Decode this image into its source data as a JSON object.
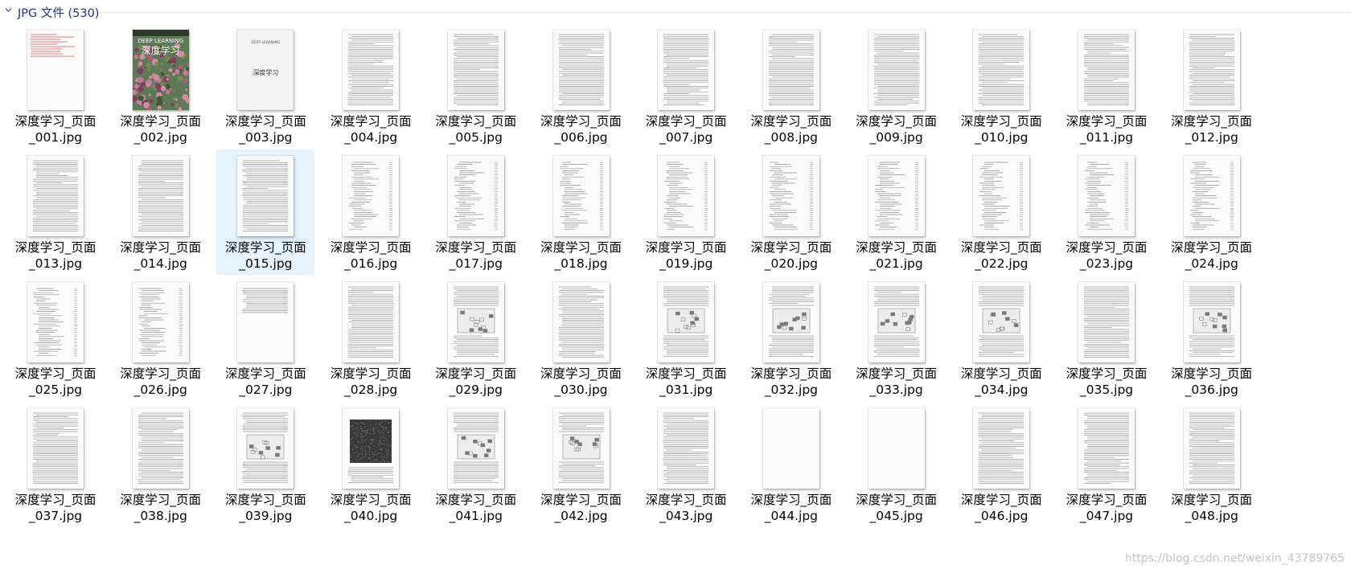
{
  "group": {
    "title": "JPG 文件 (530)",
    "chevron_icon": "chevron-down-icon"
  },
  "watermark": "https://blog.csdn.net/weixin_43789765",
  "colors": {
    "header_text": "#1e3287",
    "selection": "#e5f3ff"
  },
  "selected_index": 14,
  "covers": {
    "2": {
      "top": "DEEP LEARNING",
      "title": "深度学习"
    },
    "3": {
      "top": "DEEP LEARNING",
      "title": "深度学习"
    }
  },
  "files": [
    {
      "line1": "深度学习_页面",
      "line2": "_001.jpg",
      "kind": "notice"
    },
    {
      "line1": "深度学习_页面",
      "line2": "_002.jpg",
      "kind": "photo-cover"
    },
    {
      "line1": "深度学习_页面",
      "line2": "_003.jpg",
      "kind": "title-page"
    },
    {
      "line1": "深度学习_页面",
      "line2": "_004.jpg",
      "kind": "text"
    },
    {
      "line1": "深度学习_页面",
      "line2": "_005.jpg",
      "kind": "text"
    },
    {
      "line1": "深度学习_页面",
      "line2": "_006.jpg",
      "kind": "text"
    },
    {
      "line1": "深度学习_页面",
      "line2": "_007.jpg",
      "kind": "text"
    },
    {
      "line1": "深度学习_页面",
      "line2": "_008.jpg",
      "kind": "text"
    },
    {
      "line1": "深度学习_页面",
      "line2": "_009.jpg",
      "kind": "text"
    },
    {
      "line1": "深度学习_页面",
      "line2": "_010.jpg",
      "kind": "text"
    },
    {
      "line1": "深度学习_页面",
      "line2": "_011.jpg",
      "kind": "text"
    },
    {
      "line1": "深度学习_页面",
      "line2": "_012.jpg",
      "kind": "text"
    },
    {
      "line1": "深度学习_页面",
      "line2": "_013.jpg",
      "kind": "text"
    },
    {
      "line1": "深度学习_页面",
      "line2": "_014.jpg",
      "kind": "text"
    },
    {
      "line1": "深度学习_页面",
      "line2": "_015.jpg",
      "kind": "text"
    },
    {
      "line1": "深度学习_页面",
      "line2": "_016.jpg",
      "kind": "toc"
    },
    {
      "line1": "深度学习_页面",
      "line2": "_017.jpg",
      "kind": "toc"
    },
    {
      "line1": "深度学习_页面",
      "line2": "_018.jpg",
      "kind": "toc"
    },
    {
      "line1": "深度学习_页面",
      "line2": "_019.jpg",
      "kind": "toc"
    },
    {
      "line1": "深度学习_页面",
      "line2": "_020.jpg",
      "kind": "toc"
    },
    {
      "line1": "深度学习_页面",
      "line2": "_021.jpg",
      "kind": "toc"
    },
    {
      "line1": "深度学习_页面",
      "line2": "_022.jpg",
      "kind": "toc"
    },
    {
      "line1": "深度学习_页面",
      "line2": "_023.jpg",
      "kind": "toc"
    },
    {
      "line1": "深度学习_页面",
      "line2": "_024.jpg",
      "kind": "toc"
    },
    {
      "line1": "深度学习_页面",
      "line2": "_025.jpg",
      "kind": "toc"
    },
    {
      "line1": "深度学习_页面",
      "line2": "_026.jpg",
      "kind": "toc"
    },
    {
      "line1": "深度学习_页面",
      "line2": "_027.jpg",
      "kind": "short"
    },
    {
      "line1": "深度学习_页面",
      "line2": "_028.jpg",
      "kind": "text"
    },
    {
      "line1": "深度学习_页面",
      "line2": "_029.jpg",
      "kind": "figure"
    },
    {
      "line1": "深度学习_页面",
      "line2": "_030.jpg",
      "kind": "text"
    },
    {
      "line1": "深度学习_页面",
      "line2": "_031.jpg",
      "kind": "figure"
    },
    {
      "line1": "深度学习_页面",
      "line2": "_032.jpg",
      "kind": "figure"
    },
    {
      "line1": "深度学习_页面",
      "line2": "_033.jpg",
      "kind": "figure"
    },
    {
      "line1": "深度学习_页面",
      "line2": "_034.jpg",
      "kind": "figure"
    },
    {
      "line1": "深度学习_页面",
      "line2": "_035.jpg",
      "kind": "text"
    },
    {
      "line1": "深度学习_页面",
      "line2": "_036.jpg",
      "kind": "figure"
    },
    {
      "line1": "深度学习_页面",
      "line2": "_037.jpg",
      "kind": "text"
    },
    {
      "line1": "深度学习_页面",
      "line2": "_038.jpg",
      "kind": "text"
    },
    {
      "line1": "深度学习_页面",
      "line2": "_039.jpg",
      "kind": "figure"
    },
    {
      "line1": "深度学习_页面",
      "line2": "_040.jpg",
      "kind": "dark-figure"
    },
    {
      "line1": "深度学习_页面",
      "line2": "_041.jpg",
      "kind": "figure"
    },
    {
      "line1": "深度学习_页面",
      "line2": "_042.jpg",
      "kind": "figure"
    },
    {
      "line1": "深度学习_页面",
      "line2": "_043.jpg",
      "kind": "text"
    },
    {
      "line1": "深度学习_页面",
      "line2": "_044.jpg",
      "kind": "part-title"
    },
    {
      "line1": "深度学习_页面",
      "line2": "_045.jpg",
      "kind": "blank"
    },
    {
      "line1": "深度学习_页面",
      "line2": "_046.jpg",
      "kind": "text"
    },
    {
      "line1": "深度学习_页面",
      "line2": "_047.jpg",
      "kind": "text"
    },
    {
      "line1": "深度学习_页面",
      "line2": "_048.jpg",
      "kind": "text"
    }
  ]
}
